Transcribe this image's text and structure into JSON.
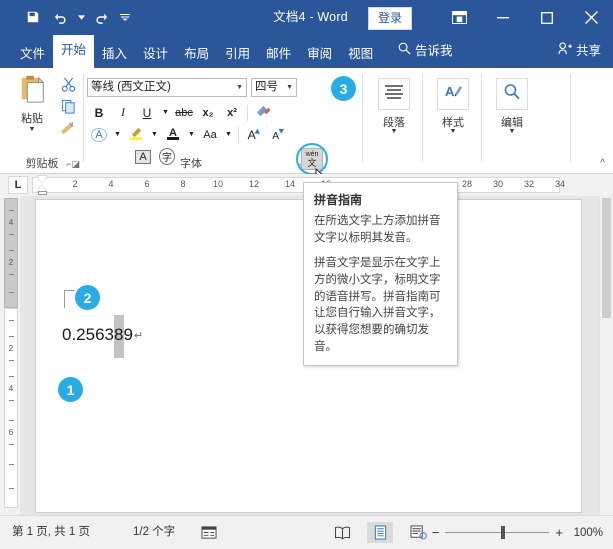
{
  "titlebar": {
    "document_title": "文档4 - Word",
    "signin_label": "登录",
    "quick_access": [
      {
        "name": "save",
        "label": "保存"
      },
      {
        "name": "undo",
        "label": "撤消"
      },
      {
        "name": "redo",
        "label": "恢复"
      },
      {
        "name": "customize",
        "label": "自定义快速访问工具栏"
      }
    ],
    "window_buttons": [
      {
        "name": "ribbon-display-options",
        "label": "功能区显示选项"
      },
      {
        "name": "minimize",
        "label": "最小化"
      },
      {
        "name": "maximize",
        "label": "最大化"
      },
      {
        "name": "close",
        "label": "关闭"
      }
    ]
  },
  "tabs": [
    {
      "label": "文件",
      "active": false
    },
    {
      "label": "开始",
      "active": true
    },
    {
      "label": "插入",
      "active": false
    },
    {
      "label": "设计",
      "active": false
    },
    {
      "label": "布局",
      "active": false
    },
    {
      "label": "引用",
      "active": false
    },
    {
      "label": "邮件",
      "active": false
    },
    {
      "label": "审阅",
      "active": false
    },
    {
      "label": "视图",
      "active": false
    }
  ],
  "tellme_label": "告诉我",
  "share_label": "共享",
  "ribbon": {
    "clipboard": {
      "group_label": "剪贴板",
      "paste_label": "粘贴",
      "cut_label": "剪切",
      "copy_label": "复制",
      "format_painter_label": "格式刷"
    },
    "font": {
      "group_label": "字体",
      "font_name": "等线 (西文正文)",
      "font_size": "四号",
      "bold": "B",
      "italic": "I",
      "underline": "U",
      "strikethrough": "abc",
      "subscript": "x₂",
      "superscript": "x²",
      "clear_format": "清除所有格式",
      "text_effects": "A",
      "highlight": "ab",
      "font_color": "A",
      "change_case": "Aa",
      "grow_font": "A",
      "shrink_font": "A",
      "char_border": "A",
      "char_shading": "字",
      "phonetic_guide_top": "wén",
      "phonetic_guide_bottom": "文"
    },
    "paragraph": {
      "group_label": "段落"
    },
    "styles": {
      "group_label": "样式"
    },
    "editing": {
      "group_label": "编辑"
    }
  },
  "ruler": {
    "tab_stop_marker": "L",
    "horizontal_numbers": [
      "2",
      "4",
      "6",
      "8",
      "10",
      "12",
      "14",
      "16",
      "28",
      "30",
      "32",
      "34"
    ],
    "vertical_margin_numbers": [
      "4",
      "2"
    ],
    "vertical_page_numbers": [
      "2",
      "4",
      "6"
    ]
  },
  "document": {
    "text_line": "0.256389",
    "paragraph_mark": "↵",
    "bullet_char": "●",
    "bullet_mark": "↵"
  },
  "tooltip": {
    "title": "拼音指南",
    "paragraphs": [
      "在所选文字上方添加拼音文字以标明其发音。",
      "拼音文字是显示在文字上方的微小文字，标明文字的语音拼写。拼音指南可让您自行输入拼音文字，以获得您想要的确切发音。"
    ]
  },
  "callouts": [
    {
      "number": "1"
    },
    {
      "number": "2"
    },
    {
      "number": "3"
    }
  ],
  "status": {
    "page_info": "第 1 页, 共 1 页",
    "word_count": "1/2 个字",
    "proofing_label": "校对",
    "views": [
      {
        "name": "read-mode",
        "label": "阅读视图",
        "selected": false
      },
      {
        "name": "print-layout",
        "label": "页面视图",
        "selected": true
      },
      {
        "name": "web-layout",
        "label": "Web 版式视图",
        "selected": false
      }
    ],
    "zoom_out": "−",
    "zoom_in": "+",
    "zoom_level": "100%"
  },
  "colors": {
    "brand": "#2b579a",
    "accent": "#29ace3",
    "page": "#ffffff",
    "canvas": "#e6e6e6"
  }
}
